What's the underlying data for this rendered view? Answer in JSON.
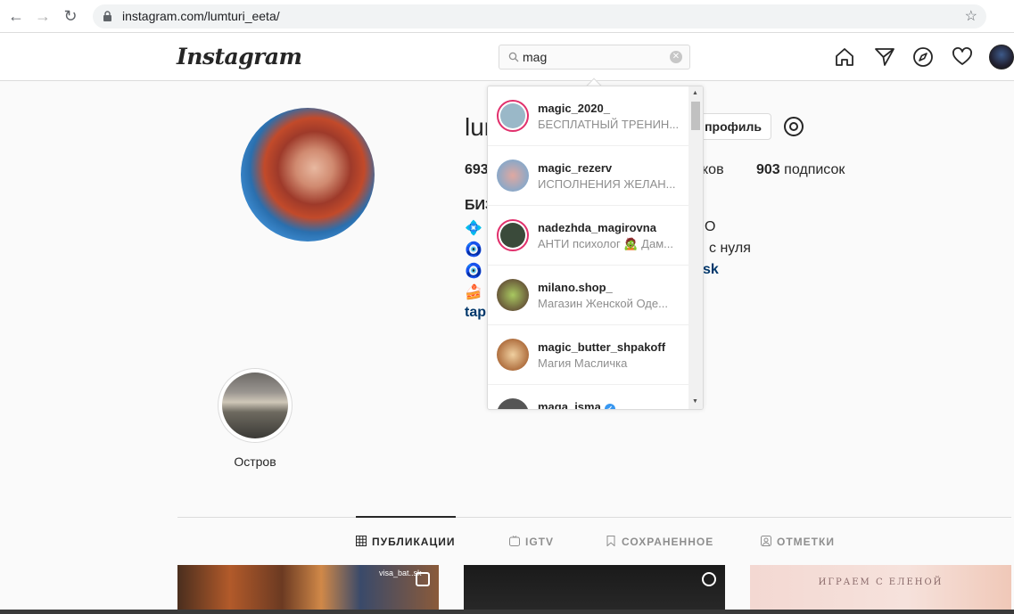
{
  "browser": {
    "url": "instagram.com/lumturi_eeta/",
    "back_icon": "arrow-left-icon",
    "forward_icon": "arrow-right-icon",
    "reload_icon": "reload-icon",
    "bookmark_icon": "star-icon"
  },
  "header": {
    "logo": "Instagram",
    "search_value": "mag",
    "icons": [
      "home-icon",
      "direct-icon",
      "explore-icon",
      "heart-icon",
      "avatar"
    ]
  },
  "profile": {
    "username_visible": "lum",
    "edit_button": "ь профиль",
    "stats": {
      "posts": "693",
      "followers_tail": "ков",
      "following": "903",
      "following_label": "подписок"
    },
    "bio_lines": [
      {
        "left": "БИЗ",
        "right": ""
      },
      {
        "left": "💠 I",
        "right": "O"
      },
      {
        "left": "🧿 И",
        "right": "с нуля"
      },
      {
        "left": "🧿 П",
        "right": "sk"
      },
      {
        "left": "🍰 I",
        "right": ""
      },
      {
        "left": "tapl",
        "right": ""
      }
    ]
  },
  "highlight": {
    "label": "Остров"
  },
  "tabs": [
    {
      "label": "ПУБЛИКАЦИИ",
      "icon": "grid-icon",
      "active": true
    },
    {
      "label": "IGTV",
      "icon": "igtv-icon",
      "active": false
    },
    {
      "label": "СОХРАНЕННОЕ",
      "icon": "bookmark-icon",
      "active": false
    },
    {
      "label": "ОТМЕТКИ",
      "icon": "tag-icon",
      "active": false
    }
  ],
  "posts": [
    {
      "tag": "visa_bat..sk"
    },
    {
      "tag": ""
    },
    {
      "caption": "ИГРАЕМ С ЕЛЕНОЙ"
    }
  ],
  "search_results": [
    {
      "name": "magic_2020_",
      "sub": "БЕСПЛАТНЫЙ ТРЕНИН...",
      "verified": false
    },
    {
      "name": "magic_rezerv",
      "sub": "ИСПОЛНЕНИЯ ЖЕЛАН...",
      "verified": false
    },
    {
      "name": "nadezhda_magirovna",
      "sub": "АНТИ психолог 🧟 Дам...",
      "verified": false
    },
    {
      "name": "milano.shop_",
      "sub": "Магазин Женской Оде...",
      "verified": false
    },
    {
      "name": "magic_butter_shpakoff",
      "sub": "Магия Масличка",
      "verified": false
    },
    {
      "name": "maga_isma",
      "sub": "",
      "verified": true
    }
  ],
  "colors": {
    "accent_link": "#00376b",
    "story_ring": "#e1306c",
    "verified": "#3897f0"
  }
}
